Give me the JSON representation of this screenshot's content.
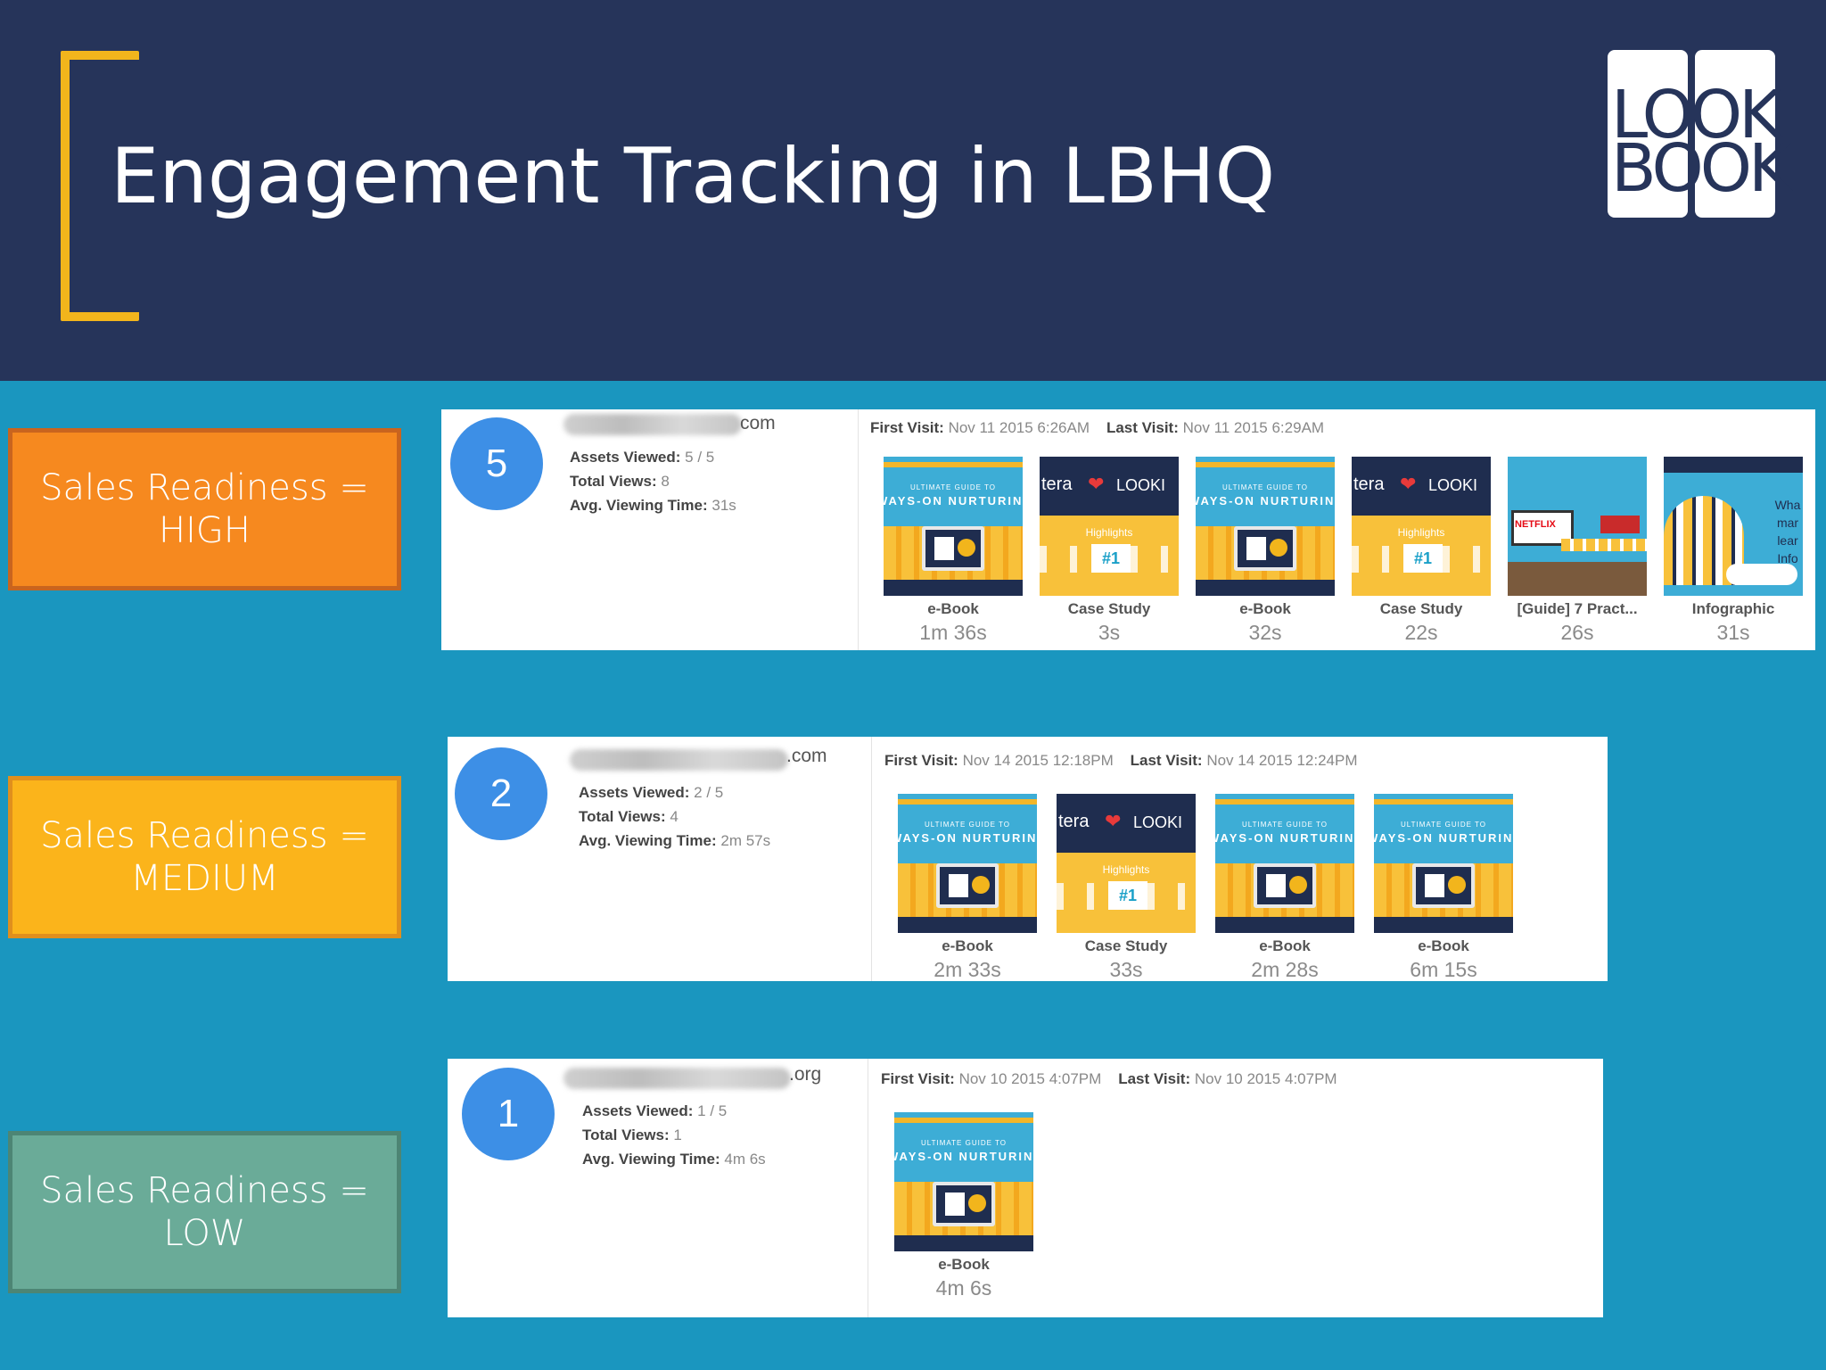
{
  "slide": {
    "title": "Engagement Tracking in LBHQ",
    "logo_lines": [
      "LOOK",
      "BOOK"
    ]
  },
  "readiness": {
    "high": {
      "line1": "Sales Readiness =",
      "line2": "HIGH",
      "color": "#f6891f"
    },
    "medium": {
      "line1": "Sales Readiness =",
      "line2": "MEDIUM",
      "color": "#fbb41b"
    },
    "low": {
      "line1": "Sales Readiness =",
      "line2": "LOW",
      "color": "#6aab98"
    }
  },
  "labels": {
    "assets_viewed": "Assets Viewed:",
    "total_views": "Total Views:",
    "avg_time": "Avg. Viewing Time:",
    "first_visit": "First Visit:",
    "last_visit": "Last Visit:"
  },
  "visitors": [
    {
      "score": "5",
      "domain_suffix": "com",
      "assets_viewed": "5 / 5",
      "total_views": "8",
      "avg_time": "31s",
      "first_visit": "Nov 11 2015 6:26AM",
      "last_visit": "Nov 11 2015 6:29AM",
      "assets": [
        {
          "kind": "ebook",
          "type": "e-Book",
          "time": "1m 36s"
        },
        {
          "kind": "case",
          "type": "Case Study",
          "time": "3s"
        },
        {
          "kind": "ebook",
          "type": "e-Book",
          "time": "32s"
        },
        {
          "kind": "case",
          "type": "Case Study",
          "time": "22s"
        },
        {
          "kind": "guide",
          "type": "[Guide] 7 Pract...",
          "time": "26s"
        },
        {
          "kind": "info",
          "type": "Infographic",
          "time": "31s"
        }
      ]
    },
    {
      "score": "2",
      "domain_suffix": ".com",
      "assets_viewed": "2 / 5",
      "total_views": "4",
      "avg_time": "2m 57s",
      "first_visit": "Nov 14 2015 12:18PM",
      "last_visit": "Nov 14 2015 12:24PM",
      "assets": [
        {
          "kind": "ebook",
          "type": "e-Book",
          "time": "2m 33s"
        },
        {
          "kind": "case",
          "type": "Case Study",
          "time": "33s"
        },
        {
          "kind": "ebook",
          "type": "e-Book",
          "time": "2m 28s"
        },
        {
          "kind": "ebook",
          "type": "e-Book",
          "time": "6m 15s"
        }
      ]
    },
    {
      "score": "1",
      "domain_suffix": ".org",
      "assets_viewed": "1 / 5",
      "total_views": "1",
      "avg_time": "4m 6s",
      "first_visit": "Nov 10 2015 4:07PM",
      "last_visit": "Nov 10 2015 4:07PM",
      "assets": [
        {
          "kind": "ebook",
          "type": "e-Book",
          "time": "4m 6s"
        }
      ]
    }
  ],
  "thumbs": {
    "ebook_line1": "ULTIMATE GUIDE TO",
    "ebook_line2": "WAYS-ON NURTURING",
    "case_tera": "tera",
    "case_logo": "LOOKI",
    "case_highlights": "Highlights",
    "case_num": "#1",
    "guide_brand": "NETFLIX",
    "info_text": "Wha mar lear Info"
  }
}
